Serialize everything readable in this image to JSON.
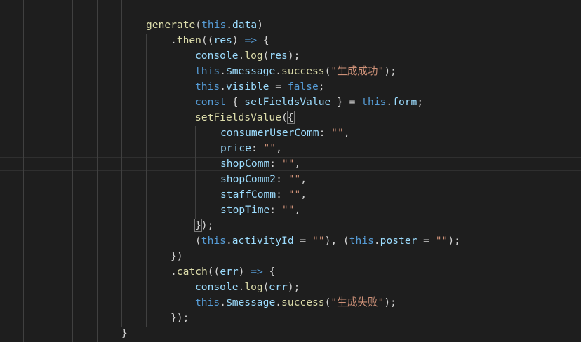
{
  "editor": {
    "colors": {
      "background": "#1e1e1e",
      "function": "#dcdcaa",
      "keyword": "#569cd6",
      "variable": "#9cdcfe",
      "string": "#ce9178",
      "punctuation": "#d4d4d4"
    },
    "lines": [
      {
        "tokens": [
          {
            "t": "generate",
            "c": "fn"
          },
          {
            "t": "(",
            "c": "punc"
          },
          {
            "t": "this",
            "c": "kw"
          },
          {
            "t": ".",
            "c": "punc"
          },
          {
            "t": "data",
            "c": "var"
          },
          {
            "t": ")",
            "c": "punc"
          }
        ]
      },
      {
        "tokens": [
          {
            "t": ".",
            "c": "punc"
          },
          {
            "t": "then",
            "c": "fn"
          },
          {
            "t": "((",
            "c": "punc"
          },
          {
            "t": "res",
            "c": "var"
          },
          {
            "t": ") ",
            "c": "punc"
          },
          {
            "t": "=>",
            "c": "kw"
          },
          {
            "t": " {",
            "c": "punc"
          }
        ]
      },
      {
        "tokens": [
          {
            "t": "console",
            "c": "var"
          },
          {
            "t": ".",
            "c": "punc"
          },
          {
            "t": "log",
            "c": "fn"
          },
          {
            "t": "(",
            "c": "punc"
          },
          {
            "t": "res",
            "c": "var"
          },
          {
            "t": ");",
            "c": "punc"
          }
        ]
      },
      {
        "tokens": [
          {
            "t": "this",
            "c": "kw"
          },
          {
            "t": ".",
            "c": "punc"
          },
          {
            "t": "$message",
            "c": "var"
          },
          {
            "t": ".",
            "c": "punc"
          },
          {
            "t": "success",
            "c": "fn"
          },
          {
            "t": "(",
            "c": "punc"
          },
          {
            "t": "\"生成成功\"",
            "c": "str"
          },
          {
            "t": ");",
            "c": "punc"
          }
        ]
      },
      {
        "tokens": [
          {
            "t": "this",
            "c": "kw"
          },
          {
            "t": ".",
            "c": "punc"
          },
          {
            "t": "visible",
            "c": "var"
          },
          {
            "t": " = ",
            "c": "punc"
          },
          {
            "t": "false",
            "c": "kw"
          },
          {
            "t": ";",
            "c": "punc"
          }
        ]
      },
      {
        "tokens": [
          {
            "t": "const",
            "c": "kw"
          },
          {
            "t": " { ",
            "c": "punc"
          },
          {
            "t": "setFieldsValue",
            "c": "var"
          },
          {
            "t": " } = ",
            "c": "punc"
          },
          {
            "t": "this",
            "c": "kw"
          },
          {
            "t": ".",
            "c": "punc"
          },
          {
            "t": "form",
            "c": "var"
          },
          {
            "t": ";",
            "c": "punc"
          }
        ]
      },
      {
        "tokens": [
          {
            "t": "setFieldsValue",
            "c": "fn"
          },
          {
            "t": "(",
            "c": "punc"
          },
          {
            "t": "{",
            "c": "bracket"
          }
        ]
      },
      {
        "tokens": [
          {
            "t": "consumerUserComm",
            "c": "var"
          },
          {
            "t": ": ",
            "c": "punc"
          },
          {
            "t": "\"\"",
            "c": "str"
          },
          {
            "t": ",",
            "c": "punc"
          }
        ]
      },
      {
        "tokens": [
          {
            "t": "price",
            "c": "var"
          },
          {
            "t": ": ",
            "c": "punc"
          },
          {
            "t": "\"\"",
            "c": "str"
          },
          {
            "t": ",",
            "c": "punc"
          }
        ]
      },
      {
        "tokens": [
          {
            "t": "shopComm",
            "c": "var"
          },
          {
            "t": ": ",
            "c": "punc"
          },
          {
            "t": "\"\"",
            "c": "str"
          },
          {
            "t": ",",
            "c": "punc"
          }
        ]
      },
      {
        "tokens": [
          {
            "t": "shopComm2",
            "c": "var"
          },
          {
            "t": ": ",
            "c": "punc"
          },
          {
            "t": "\"\"",
            "c": "str"
          },
          {
            "t": ",",
            "c": "punc"
          }
        ]
      },
      {
        "tokens": [
          {
            "t": "staffComm",
            "c": "var"
          },
          {
            "t": ": ",
            "c": "punc"
          },
          {
            "t": "\"\"",
            "c": "str"
          },
          {
            "t": ",",
            "c": "punc"
          }
        ]
      },
      {
        "tokens": [
          {
            "t": "stopTime",
            "c": "var"
          },
          {
            "t": ": ",
            "c": "punc"
          },
          {
            "t": "\"\"",
            "c": "str"
          },
          {
            "t": ",",
            "c": "punc"
          }
        ]
      },
      {
        "tokens": [
          {
            "t": "}",
            "c": "bracket"
          },
          {
            "t": ");",
            "c": "punc"
          }
        ]
      },
      {
        "tokens": [
          {
            "t": "(",
            "c": "punc"
          },
          {
            "t": "this",
            "c": "kw"
          },
          {
            "t": ".",
            "c": "punc"
          },
          {
            "t": "activityId",
            "c": "var"
          },
          {
            "t": " = ",
            "c": "punc"
          },
          {
            "t": "\"\"",
            "c": "str"
          },
          {
            "t": "), (",
            "c": "punc"
          },
          {
            "t": "this",
            "c": "kw"
          },
          {
            "t": ".",
            "c": "punc"
          },
          {
            "t": "poster",
            "c": "var"
          },
          {
            "t": " = ",
            "c": "punc"
          },
          {
            "t": "\"\"",
            "c": "str"
          },
          {
            "t": ");",
            "c": "punc"
          }
        ]
      },
      {
        "tokens": [
          {
            "t": "})",
            "c": "punc"
          }
        ]
      },
      {
        "tokens": [
          {
            "t": ".",
            "c": "punc"
          },
          {
            "t": "catch",
            "c": "fn"
          },
          {
            "t": "((",
            "c": "punc"
          },
          {
            "t": "err",
            "c": "var"
          },
          {
            "t": ") ",
            "c": "punc"
          },
          {
            "t": "=>",
            "c": "kw"
          },
          {
            "t": " {",
            "c": "punc"
          }
        ]
      },
      {
        "tokens": [
          {
            "t": "console",
            "c": "var"
          },
          {
            "t": ".",
            "c": "punc"
          },
          {
            "t": "log",
            "c": "fn"
          },
          {
            "t": "(",
            "c": "punc"
          },
          {
            "t": "err",
            "c": "var"
          },
          {
            "t": ");",
            "c": "punc"
          }
        ]
      },
      {
        "tokens": [
          {
            "t": "this",
            "c": "kw"
          },
          {
            "t": ".",
            "c": "punc"
          },
          {
            "t": "$message",
            "c": "var"
          },
          {
            "t": ".",
            "c": "punc"
          },
          {
            "t": "success",
            "c": "fn"
          },
          {
            "t": "(",
            "c": "punc"
          },
          {
            "t": "\"生成失败\"",
            "c": "str"
          },
          {
            "t": ");",
            "c": "punc"
          }
        ]
      },
      {
        "tokens": [
          {
            "t": "});",
            "c": "punc"
          }
        ]
      },
      {
        "tokens": [
          {
            "t": "}",
            "c": "punc"
          }
        ]
      }
    ]
  }
}
